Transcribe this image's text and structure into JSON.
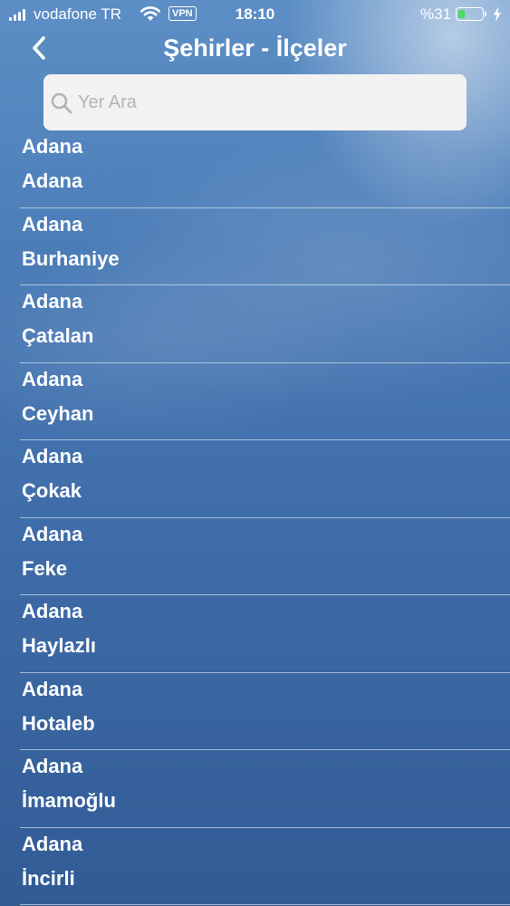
{
  "status_bar": {
    "carrier": "vodafone TR",
    "vpn": "VPN",
    "time": "18:10",
    "battery_text": "%31",
    "battery_level": 0.31,
    "battery_color": "#4cd964"
  },
  "nav": {
    "back_icon": "chevron-left-icon",
    "title": "Şehirler - İlçeler"
  },
  "search": {
    "placeholder": "Yer Ara",
    "value": "",
    "icon": "search-icon"
  },
  "list": {
    "items": [
      {
        "city": "Adana",
        "district": "Adana"
      },
      {
        "city": "Adana",
        "district": "Burhaniye"
      },
      {
        "city": "Adana",
        "district": "Çatalan"
      },
      {
        "city": "Adana",
        "district": "Ceyhan"
      },
      {
        "city": "Adana",
        "district": "Çokak"
      },
      {
        "city": "Adana",
        "district": "Feke"
      },
      {
        "city": "Adana",
        "district": "Haylazlı"
      },
      {
        "city": "Adana",
        "district": "Hotaleb"
      },
      {
        "city": "Adana",
        "district": "İmamoğlu"
      },
      {
        "city": "Adana",
        "district": "İncirli"
      }
    ]
  }
}
